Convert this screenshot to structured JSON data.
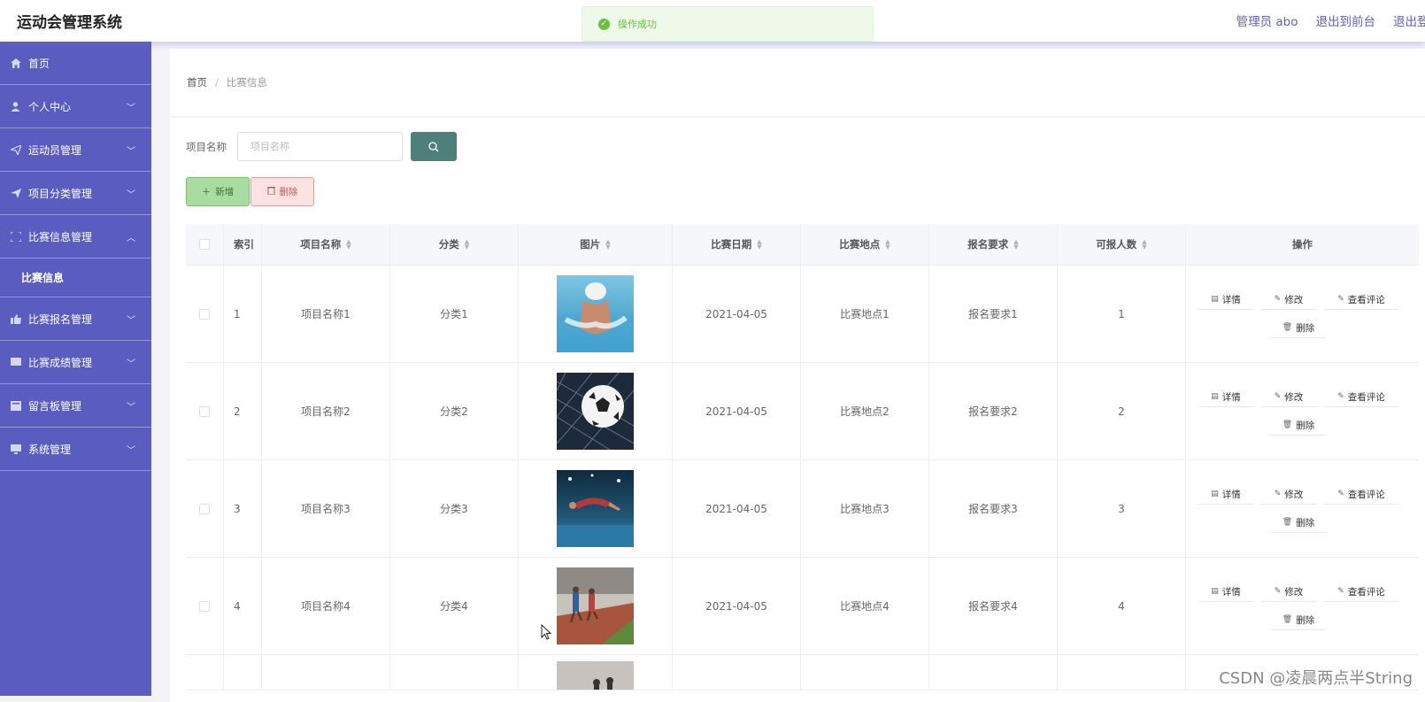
{
  "app": {
    "title": "运动会管理系统"
  },
  "header": {
    "admin": "管理员 abo",
    "to_front": "退出到前台",
    "logout": "退出登录"
  },
  "toast": {
    "text": "操作成功"
  },
  "sidebar": {
    "items": [
      {
        "label": "首页",
        "icon": "home-icon"
      },
      {
        "label": "个人中心",
        "icon": "user-icon"
      },
      {
        "label": "运动员管理",
        "icon": "send-icon"
      },
      {
        "label": "项目分类管理",
        "icon": "paper-plane-icon"
      },
      {
        "label": "比赛信息管理",
        "icon": "frame-icon"
      },
      {
        "label": "比赛报名管理",
        "icon": "thumb-icon"
      },
      {
        "label": "比赛成绩管理",
        "icon": "tablet-icon"
      },
      {
        "label": "留言板管理",
        "icon": "board-icon"
      },
      {
        "label": "系统管理",
        "icon": "monitor-icon"
      }
    ],
    "submenu": {
      "label": "比赛信息"
    }
  },
  "breadcrumb": {
    "home": "首页",
    "sep": "/",
    "current": "比赛信息"
  },
  "search": {
    "label": "项目名称",
    "placeholder": "项目名称"
  },
  "actions": {
    "add": "新增",
    "delete": "删除"
  },
  "table": {
    "headers": {
      "index": "索引",
      "name": "项目名称",
      "category": "分类",
      "picture": "图片",
      "date": "比赛日期",
      "location": "比赛地点",
      "requirement": "报名要求",
      "capacity": "可报人数",
      "operation": "操作"
    },
    "ops": {
      "detail": "详情",
      "edit": "修改",
      "comments": "查看评论",
      "delete": "删除"
    },
    "rows": [
      {
        "index": "1",
        "name": "项目名称1",
        "category": "分类1",
        "date": "2021-04-05",
        "location": "比赛地点1",
        "requirement": "报名要求1",
        "capacity": "1"
      },
      {
        "index": "2",
        "name": "项目名称2",
        "category": "分类2",
        "date": "2021-04-05",
        "location": "比赛地点2",
        "requirement": "报名要求2",
        "capacity": "2"
      },
      {
        "index": "3",
        "name": "项目名称3",
        "category": "分类3",
        "date": "2021-04-05",
        "location": "比赛地点3",
        "requirement": "报名要求3",
        "capacity": "3"
      },
      {
        "index": "4",
        "name": "项目名称4",
        "category": "分类4",
        "date": "2021-04-05",
        "location": "比赛地点4",
        "requirement": "报名要求4",
        "capacity": "4"
      }
    ]
  },
  "watermark": "CSDN @凌晨两点半String"
}
